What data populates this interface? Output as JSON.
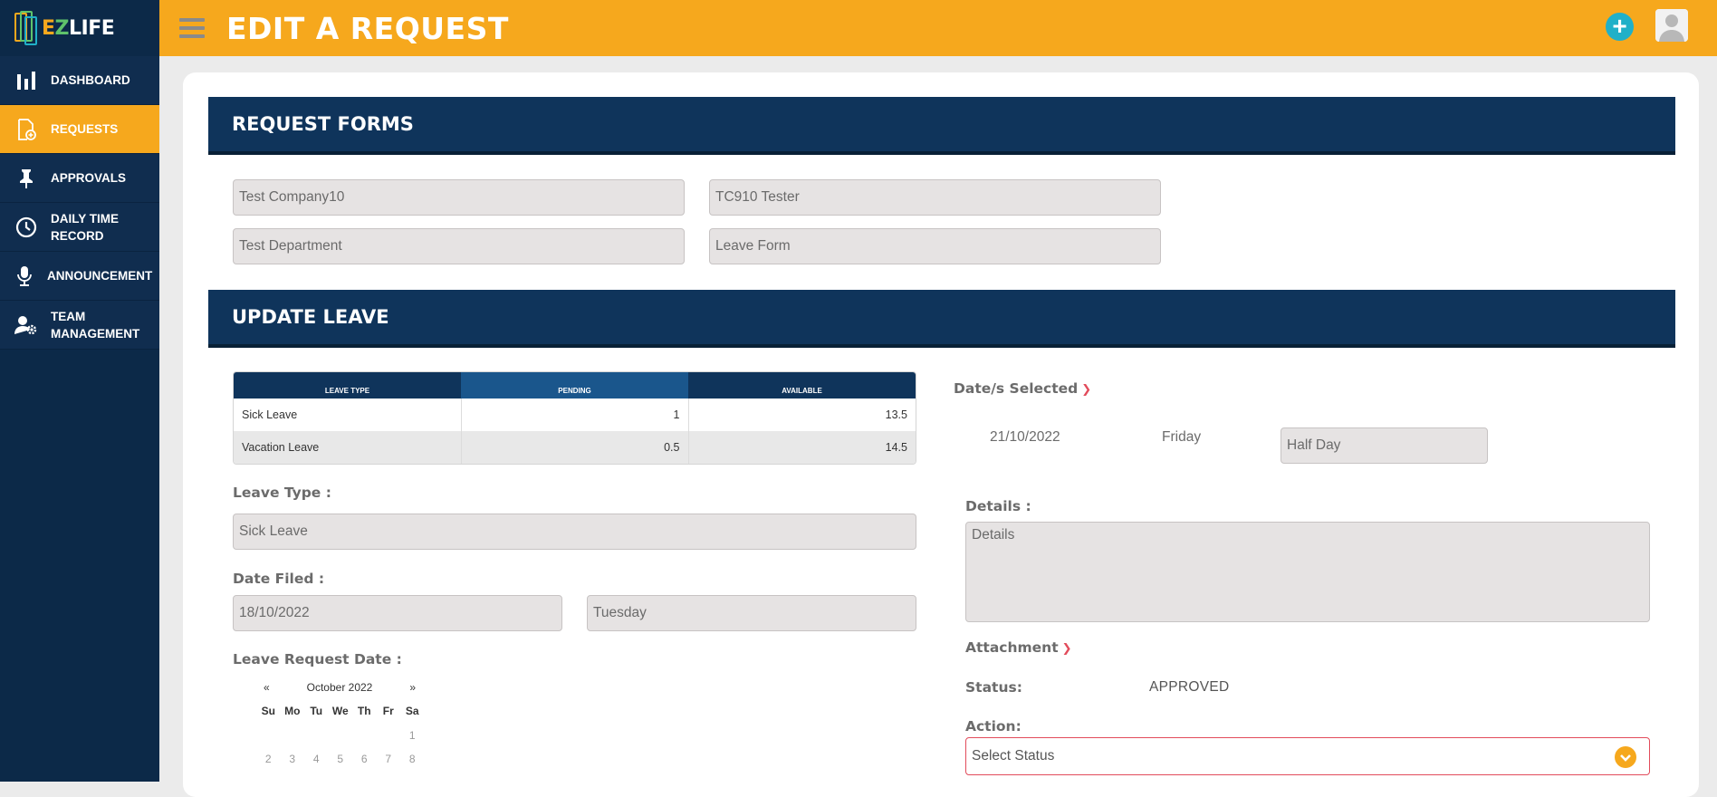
{
  "app": {
    "logo_e": "E",
    "logo_z": "Z",
    "logo_rest": "LIFE",
    "title": "EDIT A REQUEST"
  },
  "colors": {
    "brand_orange": "#f6a81d",
    "navy": "#0c2948",
    "accent_teal": "#20b0c8",
    "error_red": "#e24b5b"
  },
  "sidebar": {
    "items": [
      {
        "label": "DASHBOARD",
        "icon": "bar-chart-icon"
      },
      {
        "label": "REQUESTS",
        "icon": "document-add-icon",
        "active": true
      },
      {
        "label": "APPROVALS",
        "icon": "pin-icon"
      },
      {
        "label": "DAILY TIME RECORD",
        "line1": "DAILY TIME",
        "line2": "RECORD",
        "icon": "clock-icon"
      },
      {
        "label": "ANNOUNCEMENT",
        "icon": "microphone-icon"
      },
      {
        "label": "TEAM MANAGEMENT",
        "line1": "TEAM",
        "line2": "MANAGEMENT",
        "icon": "user-gear-icon"
      }
    ]
  },
  "header": {
    "plus": "+"
  },
  "request_forms": {
    "title": "REQUEST FORMS",
    "company": "Test Company10",
    "employee": "TC910 Tester",
    "department": "Test Department",
    "form": "Leave Form"
  },
  "update_leave": {
    "title": "UPDATE LEAVE",
    "table": {
      "headers": [
        "LEAVE TYPE",
        "PENDING",
        "AVAILABLE"
      ],
      "rows": [
        {
          "type": "Sick Leave",
          "pending": "1",
          "available": "13.5"
        },
        {
          "type": "Vacation Leave",
          "pending": "0.5",
          "available": "14.5"
        }
      ]
    },
    "leave_type_label": "Leave Type :",
    "leave_type_value": "Sick Leave",
    "date_filed_label": "Date Filed :",
    "date_filed_value": "18/10/2022",
    "date_filed_day": "Tuesday",
    "leave_request_date_label": "Leave Request Date :",
    "calendar": {
      "prev": "«",
      "month": "October 2022",
      "next": "»",
      "dows": [
        "Su",
        "Mo",
        "Tu",
        "We",
        "Th",
        "Fr",
        "Sa"
      ],
      "week1": [
        "",
        "",
        "",
        "",
        "",
        "",
        "1"
      ],
      "week2": [
        "2",
        "3",
        "4",
        "5",
        "6",
        "7",
        "8"
      ]
    },
    "dates_selected_label": "Date/s Selected",
    "selected_date": "21/10/2022",
    "selected_day": "Friday",
    "selected_duration": "Half Day",
    "details_label": "Details :",
    "details_placeholder": "Details",
    "attachment_label": "Attachment",
    "status_label": "Status:",
    "status_value": "APPROVED",
    "action_label": "Action:",
    "action_placeholder": "Select Status"
  }
}
